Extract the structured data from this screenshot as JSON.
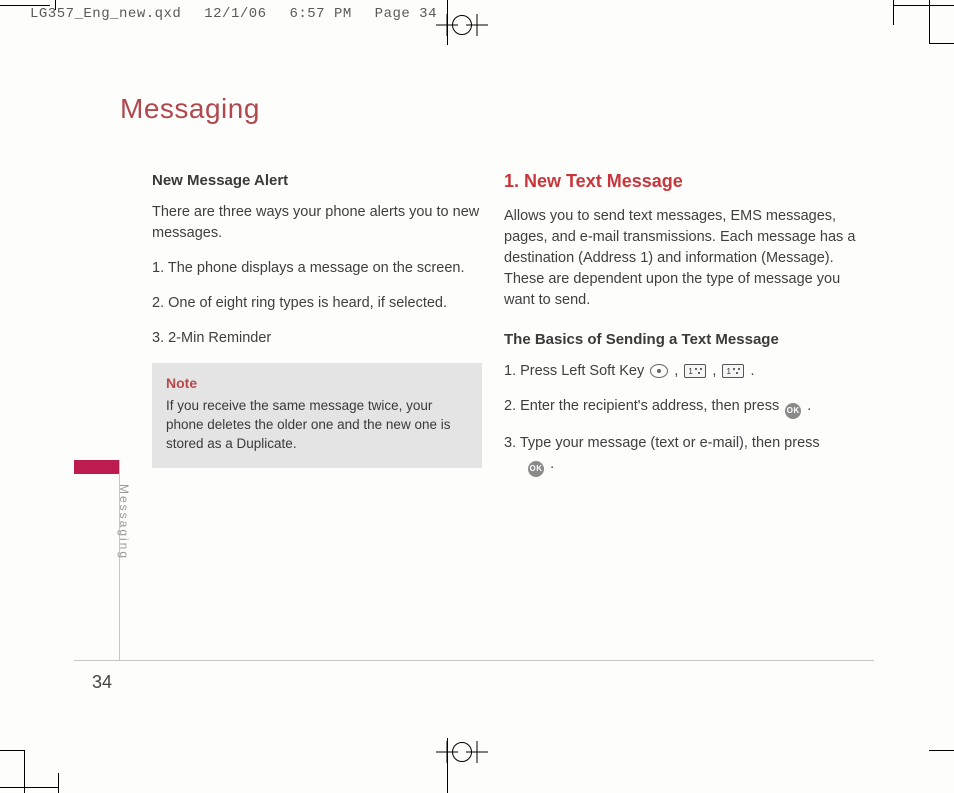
{
  "print_header": {
    "file": "LG357_Eng_new.qxd",
    "date": "12/1/06",
    "time": "6:57 PM",
    "page_label": "Page 34"
  },
  "page_title": "Messaging",
  "side_tab": "Messaging",
  "page_number": "34",
  "left": {
    "heading": "New Message Alert",
    "intro": "There are three ways your phone alerts you to new messages.",
    "items": [
      "1. The phone displays a message on the screen.",
      "2. One of eight ring types is heard, if selected.",
      "3. 2-Min Reminder"
    ],
    "note_title": "Note",
    "note_body": "If you receive the same message twice, your phone deletes the older one and the new one is stored as a Duplicate."
  },
  "right": {
    "heading": "1. New Text Message",
    "intro": "Allows you to send text messages, EMS messages, pages, and e-mail transmissions. Each message has a destination (Address 1) and information (Message). These are dependent upon the type of message you want to send.",
    "subhead": "The Basics of Sending a Text Message",
    "step1_a": "1. Press Left Soft Key ",
    "step1_b": ", ",
    "step1_c": ", ",
    "step1_d": ".",
    "step2_a": "2. Enter the recipient's address, then press ",
    "step2_b": ".",
    "step3_a": "3. Type your message (text or e-mail), then press",
    "step3_b": "."
  },
  "icons": {
    "soft_key": "soft-key-icon",
    "ok_key": "ok-key-icon",
    "num_key": "number-key-icon",
    "ok_label": "OK"
  }
}
